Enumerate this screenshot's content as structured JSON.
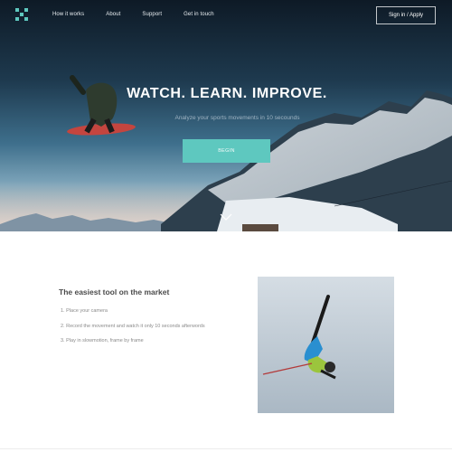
{
  "nav": {
    "links": [
      "How it works",
      "About",
      "Support",
      "Get in touch"
    ],
    "signin_label": "Sign in / Apply"
  },
  "hero": {
    "headline": "WATCH. LEARN. IMPROVE.",
    "subline": "Analyze your sports movements in 10 secounds",
    "cta_label": "BEGIN"
  },
  "content": {
    "title": "The easiest tool on the market",
    "steps": [
      "1. Place your camera",
      "2. Record the movement and watch it only 10 seconds afterwords",
      "3. Play in slowmotion, frame by frame"
    ]
  },
  "colors": {
    "accent": "#5ec8bf",
    "hero_dark": "#0e1a26"
  }
}
